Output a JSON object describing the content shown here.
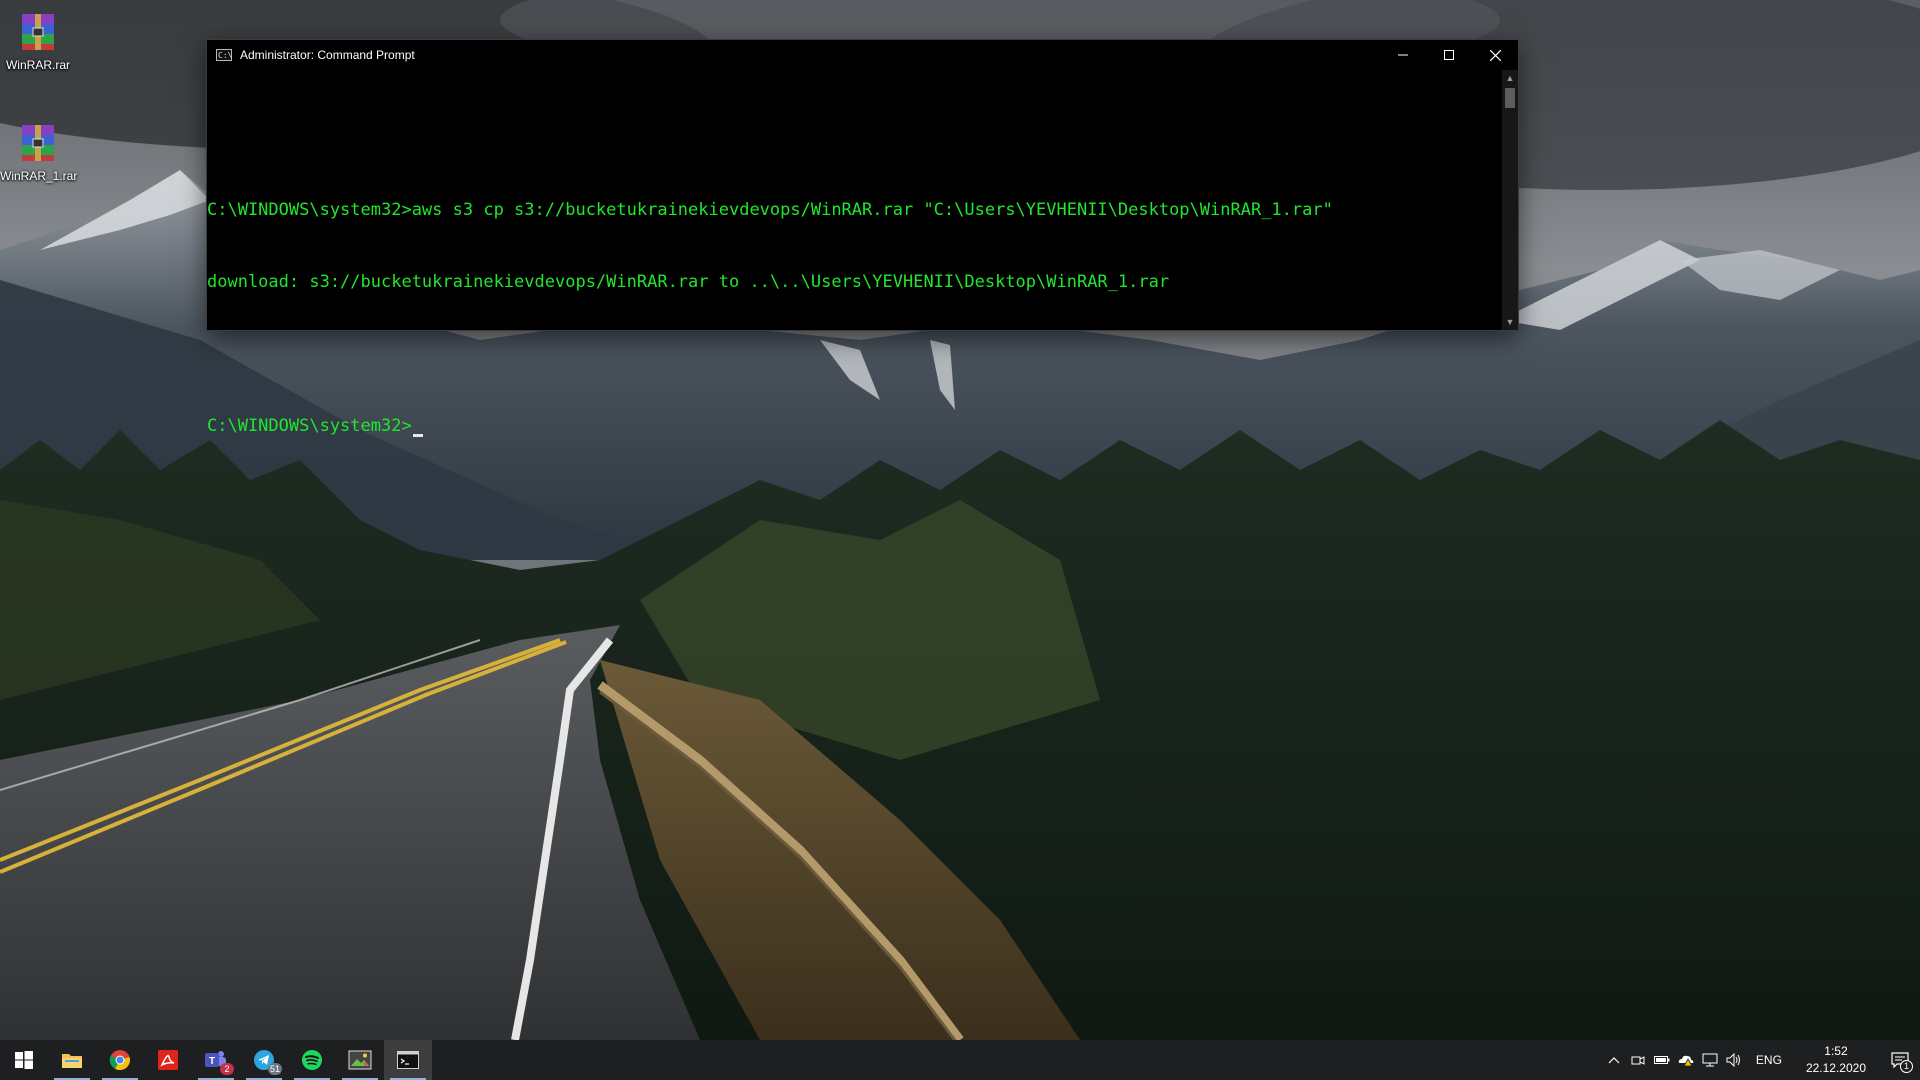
{
  "desktop": {
    "icons": [
      {
        "label": "WinRAR.rar",
        "icon": "winrar-archive-icon"
      },
      {
        "label": "WinRAR_1.rar",
        "icon": "winrar-archive-icon"
      }
    ]
  },
  "cmd_window": {
    "title": "Administrator: Command Prompt",
    "lines": [
      "",
      "C:\\WINDOWS\\system32>aws s3 cp s3://bucketukrainekievdevops/WinRAR.rar \"C:\\Users\\YEVHENII\\Desktop\\WinRAR_1.rar\"",
      "download: s3://bucketukrainekievdevops/WinRAR.rar to ..\\..\\Users\\YEVHENII\\Desktop\\WinRAR_1.rar",
      ""
    ],
    "prompt": "C:\\WINDOWS\\system32>",
    "text_color": "#20e62d"
  },
  "taskbar": {
    "apps": [
      {
        "name": "start",
        "icon": "windows-logo-icon"
      },
      {
        "name": "file-explorer",
        "icon": "folder-icon"
      },
      {
        "name": "chrome",
        "icon": "chrome-icon"
      },
      {
        "name": "acrobat",
        "icon": "acrobat-icon"
      },
      {
        "name": "teams",
        "icon": "teams-icon",
        "badge": "2"
      },
      {
        "name": "telegram",
        "icon": "telegram-icon",
        "badge": "51"
      },
      {
        "name": "spotify",
        "icon": "spotify-icon"
      },
      {
        "name": "photos",
        "icon": "photos-icon"
      },
      {
        "name": "command-prompt",
        "icon": "cmd-icon"
      }
    ],
    "tray": {
      "language": "ENG",
      "time": "1:52",
      "date": "22.12.2020",
      "notification_count": "1"
    }
  }
}
